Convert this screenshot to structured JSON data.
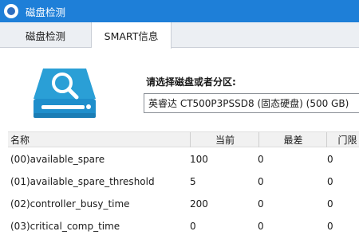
{
  "window": {
    "title": "磁盘检测"
  },
  "tabs": [
    {
      "label": "磁盘检测"
    },
    {
      "label": "SMART信息"
    }
  ],
  "selector": {
    "label": "请选择磁盘或者分区:",
    "value": "英睿达 CT500P3PSSD8 (固态硬盘)  (500 GB)"
  },
  "table": {
    "headers": [
      "名称",
      "当前",
      "最差",
      "门限"
    ],
    "rows": [
      {
        "name": "(00)available_spare",
        "current": "100",
        "worst": "0",
        "threshold": "0"
      },
      {
        "name": "(01)available_spare_threshold",
        "current": "5",
        "worst": "0",
        "threshold": "0"
      },
      {
        "name": "(02)controller_busy_time",
        "current": "200",
        "worst": "0",
        "threshold": "0"
      },
      {
        "name": "(03)critical_comp_time",
        "current": "0",
        "worst": "0",
        "threshold": "0"
      }
    ]
  }
}
